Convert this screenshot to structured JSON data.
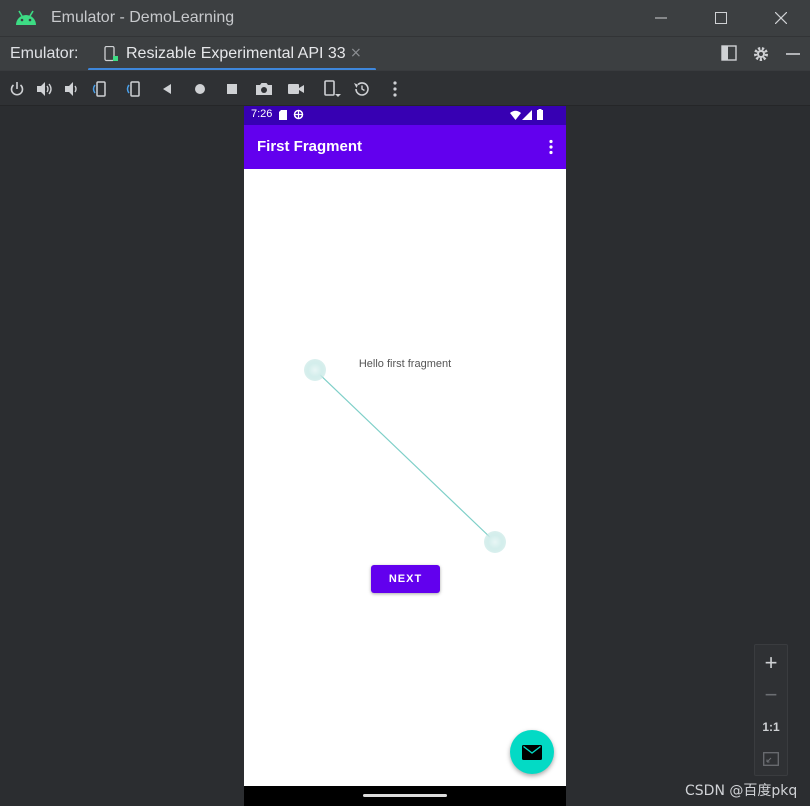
{
  "window": {
    "title": "Emulator - DemoLearning",
    "logo_icon": "android-logo-icon",
    "minimize_icon": "minimize-icon",
    "maximize_icon": "maximize-icon",
    "close_icon": "close-icon"
  },
  "tabs": {
    "caption": "Emulator:",
    "device_tab": {
      "label": "Resizable Experimental API 33",
      "close": "×"
    }
  },
  "toolbar": {
    "items": [
      "power-icon",
      "volume-up-icon",
      "volume-down-icon",
      "rotate-left-icon",
      "rotate-right-icon",
      "back-icon",
      "home-icon",
      "overview-icon",
      "screenshot-icon",
      "screen-record-icon",
      "fold-icon",
      "snapshot-icon",
      "more-icon"
    ]
  },
  "phone": {
    "status_time": "7:26",
    "appbar_title": "First Fragment",
    "content_text": "Hello first fragment",
    "next_button": "NEXT",
    "fab_icon": "mail-icon"
  },
  "zoom": {
    "zoom_in": "+",
    "zoom_out": "−",
    "actual_size": "1:1"
  },
  "watermark": "CSDN @百度pkq",
  "colors": {
    "status_bar": "#3700b3",
    "app_bar": "#6200ee",
    "fab": "#03dac5",
    "tab_underline": "#3e87db"
  }
}
